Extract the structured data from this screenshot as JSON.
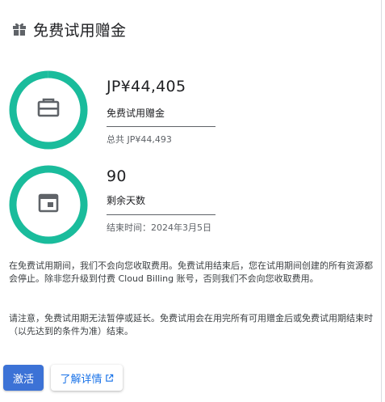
{
  "header": {
    "icon": "gift-icon",
    "title": "免费试用赠金"
  },
  "credit": {
    "icon": "credit-card-icon",
    "value": "JP¥44,405",
    "label": "免费试用赠金",
    "total": "总共 JP¥44,493",
    "remaining_fraction": 0.998,
    "ring_color": "#1abc9c"
  },
  "days": {
    "icon": "calendar-icon",
    "value": "90",
    "label": "剩余天数",
    "end_date": "结束时间：2024年3月5日",
    "remaining_fraction": 1.0,
    "ring_color": "#1abc9c"
  },
  "paragraphs": {
    "p1": "在免费试用期间，我们不会向您收取费用。免费试用结束后，您在试用期间创建的所有资源都会停止。除非您升级到付费 Cloud Billing 账号，否则我们不会向您收取费用。",
    "p2": "请注意，免费试用期无法暂停或延长。免费试用会在用完所有可用赠金后或免费试用期结束时（以先达到的条件为准）结束。"
  },
  "actions": {
    "activate_label": "激活",
    "learn_more_label": "了解详情",
    "learn_more_icon": "open-in-new-icon",
    "primary_color": "#3c72d6",
    "link_color": "#1a73e8"
  }
}
